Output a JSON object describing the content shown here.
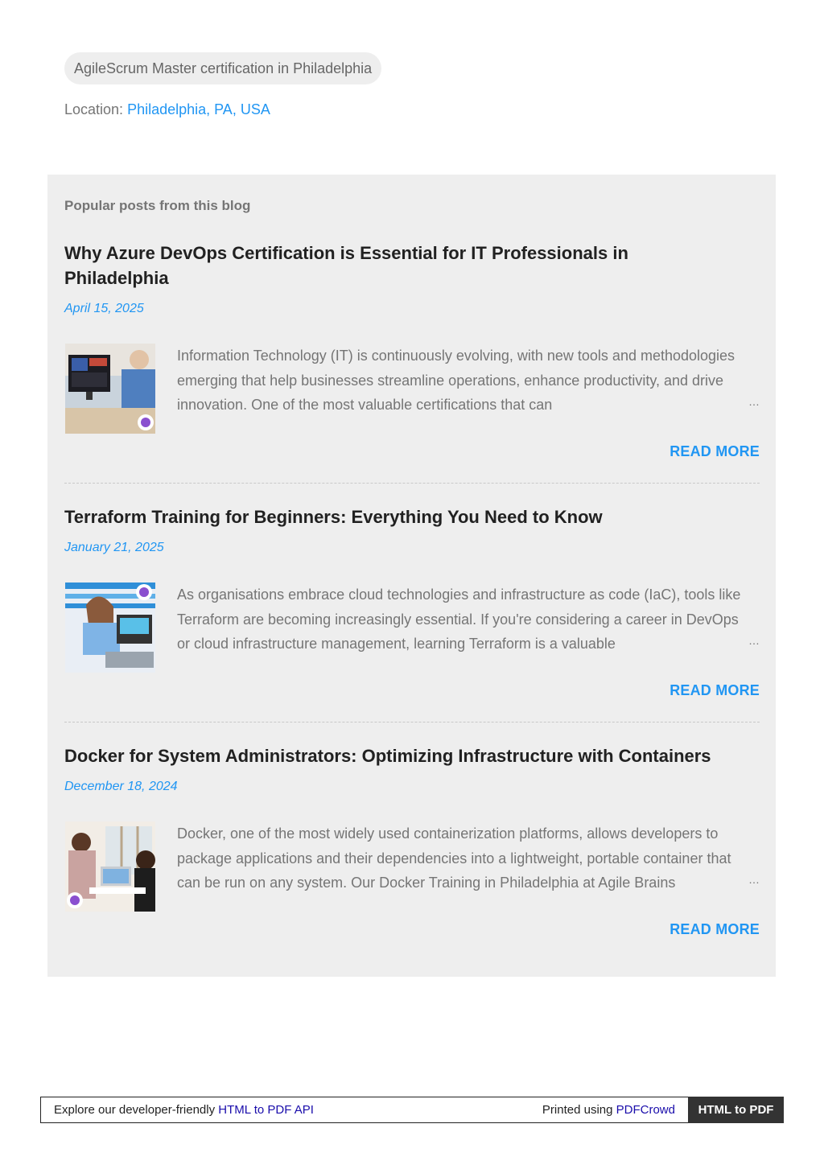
{
  "label": "AgileScrum Master certification in Philadelphia",
  "location": {
    "prefix": "Location: ",
    "value": "Philadelphia, PA, USA"
  },
  "popular": {
    "heading": "Popular posts from this blog",
    "posts": [
      {
        "title": "Why Azure DevOps Certification is Essential for IT Professionals in Philadelphia",
        "date": "April 15, 2025",
        "snippet": "Information Technology (IT) is continuously evolving, with new tools and methodologies emerging that help businesses streamline operations, enhance productivity, and drive innovation. One of the most valuable certifications that can",
        "ellipsis": "…",
        "read_more": "READ MORE",
        "thumb_icon": "developer-at-monitor-image"
      },
      {
        "title": "Terraform Training for Beginners: Everything You Need to Know",
        "date": "January 21, 2025",
        "snippet": "As organisations embrace cloud technologies and infrastructure as code (IaC), tools like Terraform are becoming increasingly essential. If you're considering a career in DevOps or cloud infrastructure management, learning Terraform is a valuable",
        "ellipsis": "…",
        "read_more": "READ MORE",
        "thumb_icon": "woman-with-electronics-image"
      },
      {
        "title": "Docker for System Administrators: Optimizing Infrastructure with Containers",
        "date": "December 18, 2024",
        "snippet": "Docker, one of the most widely used containerization platforms, allows developers to package applications and their dependencies into a lightweight, portable container that can be run on any system. Our Docker Training in Philadelphia at Agile Brains",
        "ellipsis": "…",
        "read_more": "READ MORE",
        "thumb_icon": "office-meeting-image"
      }
    ]
  },
  "footer": {
    "left_text": "Explore our developer-friendly ",
    "left_link": "HTML to PDF API",
    "right_text": "Printed using ",
    "right_link": "PDFCrowd",
    "badge": "HTML to PDF"
  },
  "colors": {
    "accent": "#2196f3",
    "panel_bg": "#eeeeee",
    "muted_text": "#757575"
  }
}
